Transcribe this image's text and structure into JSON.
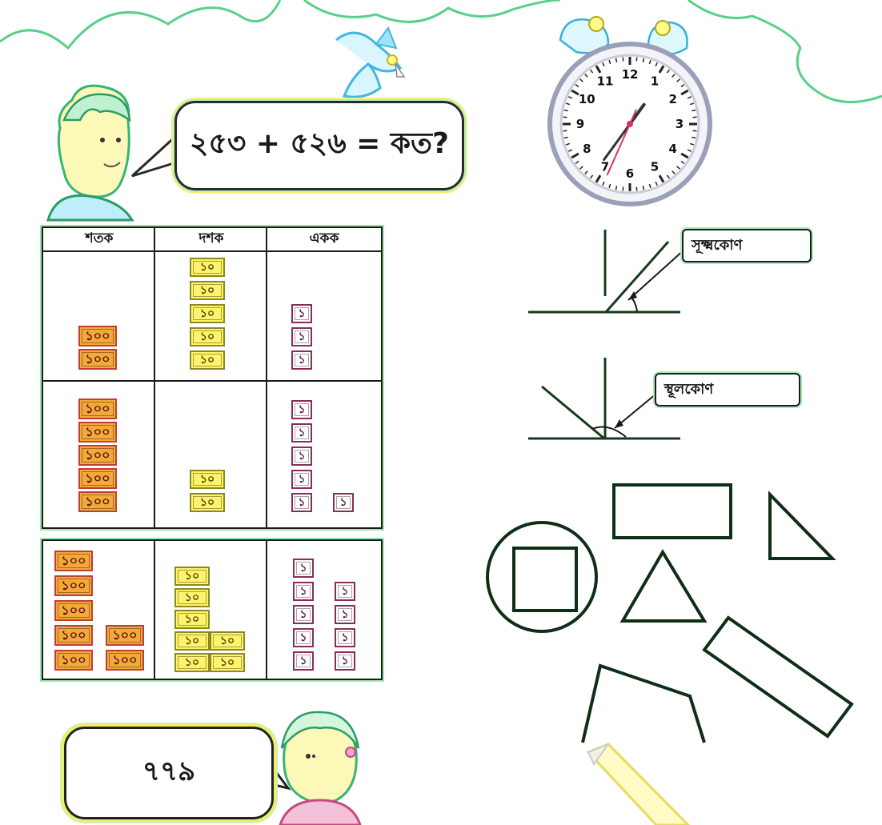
{
  "question": {
    "text": "২৫৩ + ৫২৬ = কত?"
  },
  "answer": {
    "text": "৭৭৯"
  },
  "table": {
    "headers": [
      "শতক",
      "দশক",
      "একক"
    ],
    "rows": [
      {
        "hundreds": 2,
        "tens": 5,
        "ones": 3
      },
      {
        "hundreds": 5,
        "tens": 2,
        "ones": 6
      },
      {
        "hundreds": 7,
        "tens": 7,
        "ones": 9
      }
    ],
    "labels": {
      "hundred": "১০০",
      "ten": "১০",
      "one": "১"
    }
  },
  "angles": {
    "acute": "সূক্ষ্মকোণ",
    "obtuse": "স্থূলকোণ"
  },
  "clock": {
    "numbers": [
      "12",
      "1",
      "2",
      "3",
      "4",
      "5",
      "6",
      "7",
      "8",
      "9",
      "10",
      "11"
    ],
    "hour": 1.2,
    "minute": 36,
    "second": 34
  },
  "colors": {
    "outline": "#1a1a1a",
    "glow_green": "#7fe39a",
    "glow_yellow": "#f3ef6a",
    "hand_red": "#e0306a",
    "cloud": "#5fd68a"
  },
  "icons": [
    "cloud-outline-icon",
    "bird-icon",
    "boy-icon",
    "girl-icon",
    "alarm-clock-icon",
    "pencil-icon"
  ]
}
